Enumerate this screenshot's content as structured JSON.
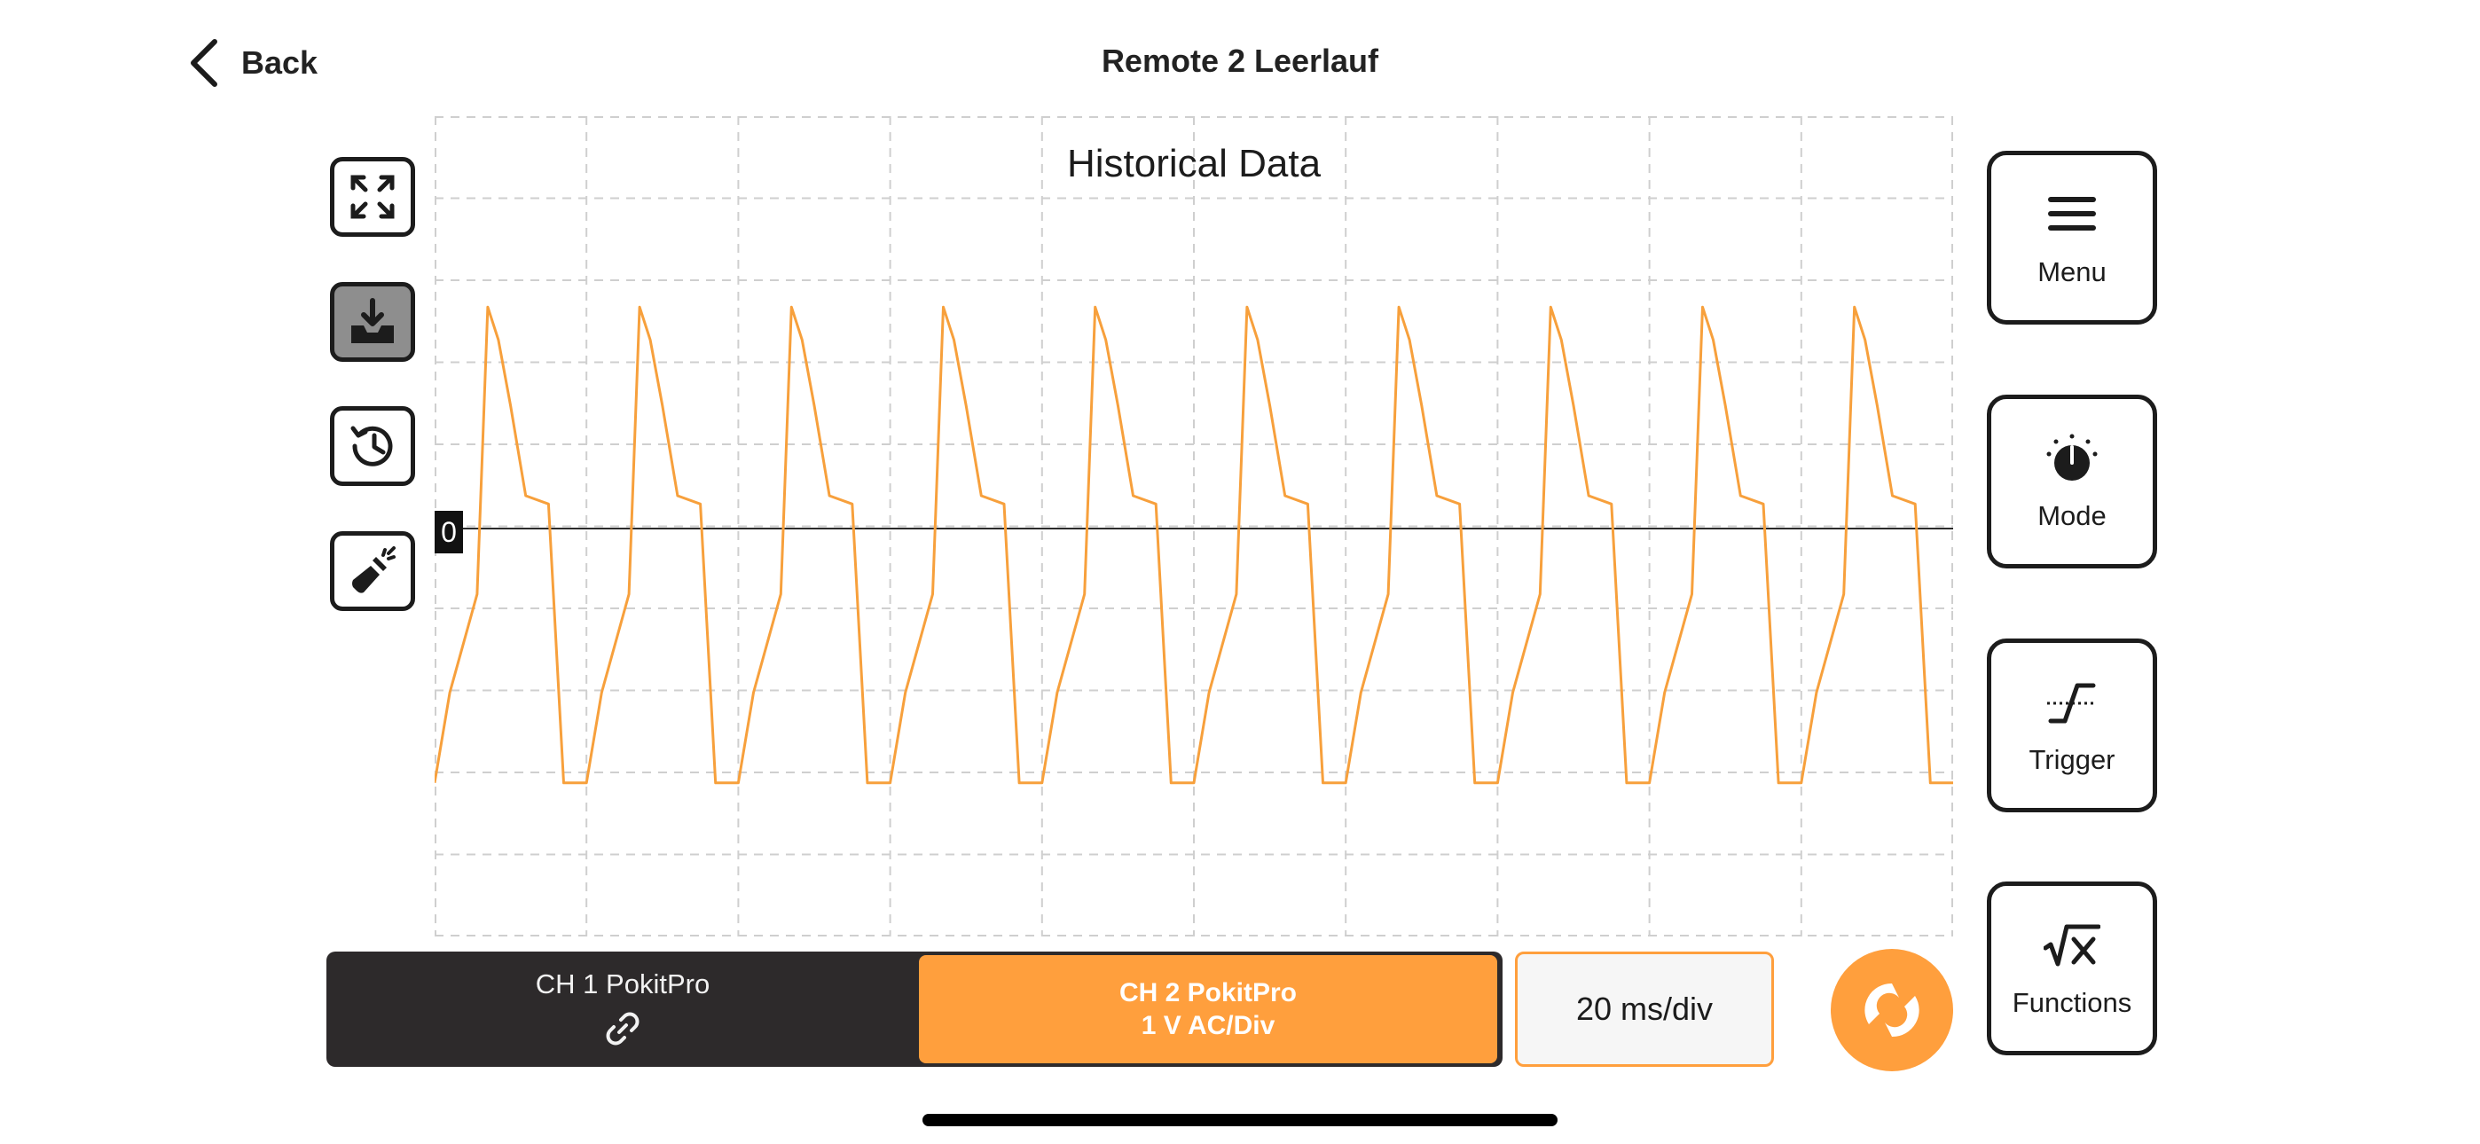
{
  "header": {
    "back_label": "Back",
    "title": "Remote 2 Leerlauf"
  },
  "plot": {
    "title": "Historical Data",
    "zero_label": "0",
    "grid": {
      "divisions_x": 10,
      "divisions_y": 10
    }
  },
  "toolbar_left": [
    {
      "icon": "fullscreen-icon"
    },
    {
      "icon": "download-icon",
      "active": true
    },
    {
      "icon": "history-icon"
    },
    {
      "icon": "flashlight-icon"
    }
  ],
  "side_buttons": {
    "menu": "Menu",
    "mode": "Mode",
    "trigger": "Trigger",
    "functions": "Functions"
  },
  "channels": {
    "ch1": {
      "label": "CH 1 PokitPro",
      "icon": "link-icon"
    },
    "ch2": {
      "label": "CH 2 PokitPro",
      "scale": "1 V AC/Div",
      "color": "#ff9f3d"
    }
  },
  "timebase": "20 ms/div",
  "colors": {
    "accent": "#ff9f3d",
    "dark": "#2d2a2b",
    "trace": "#f7a03c"
  },
  "chart_data": {
    "type": "line",
    "title": "Historical Data",
    "xlabel": "",
    "ylabel": "",
    "x_divisions": 10,
    "y_divisions": 10,
    "series": [
      {
        "cycles": 10,
        "x_div": [
          0.0,
          0.1,
          0.28,
          0.35,
          0.42,
          0.5,
          0.6,
          0.75,
          0.85,
          0.95,
          1.0
        ],
        "y_div": [
          -3.1,
          -2.0,
          -0.8,
          2.7,
          2.3,
          1.5,
          0.4,
          0.3,
          -3.1,
          -3.1,
          -3.1
        ]
      }
    ]
  }
}
